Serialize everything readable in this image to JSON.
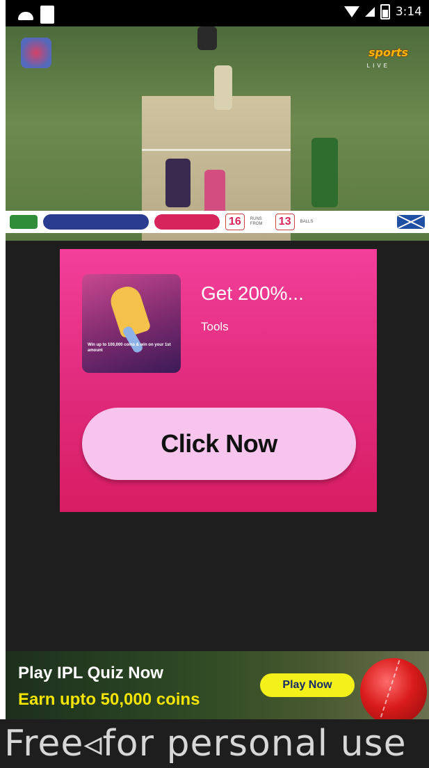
{
  "status_bar": {
    "time": "3:14",
    "icons": [
      "android-icon",
      "notification-icon",
      "wifi-icon",
      "signal-icon",
      "battery-icon"
    ]
  },
  "video": {
    "channel_logo": "sports",
    "live_label": "LIVE",
    "score": {
      "runs_left": "16",
      "runs_right": "13",
      "runs_left_label": "RUNS FROM",
      "runs_right_label": "BALLS"
    }
  },
  "ad": {
    "title": "Get 200%...",
    "category": "Tools",
    "thumb_text": "Win up to 100,000 coins & win on your 1st amount",
    "cta_label": "Click Now",
    "colors": {
      "top": "#f33f9a",
      "bottom": "#d81d63",
      "cta": "#f6c4ec"
    }
  },
  "banner": {
    "title": "Play IPL Quiz Now",
    "subtitle": "Earn upto 50,000 coins",
    "button_label": "Play Now"
  },
  "watermark": {
    "text": "Free◃for personal use"
  }
}
